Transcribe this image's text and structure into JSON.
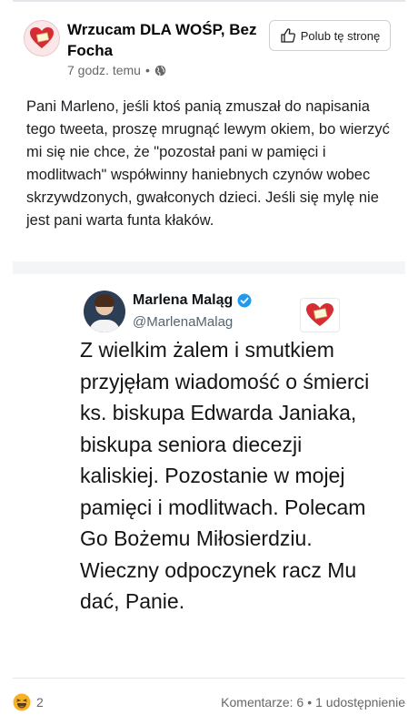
{
  "post": {
    "page_name": "Wrzucam DLA WOŚP, Bez Focha",
    "time": "7 godz. temu",
    "separator": "•",
    "like_page_button": "Polub tę stronę",
    "text": "Pani Marleno, jeśli ktoś panią zmuszał do napisania tego tweeta, proszę mrugnąć lewym okiem, bo wierzyć mi się nie chce, że \"pozostał pani w pamięci i modlitwach\" współwinny haniebnych czynów wobec skrzywdzonych, gwałconych dzieci. Jeśli się mylę nie jest pani warta funta kłaków."
  },
  "tweet": {
    "name": "Marlena Maląg",
    "handle": "@MarlenaMalag",
    "text": "Z wielkim żalem i smutkiem przyjęłam wiadomość o śmierci ks. biskupa Edwarda Janiaka, biskupa seniora diecezji kaliskiej. Pozostanie w mojej pamięci i modlitwach. Polecam Go Bożemu Miłosierdziu. Wieczny odpoczynek racz Mu dać, Panie."
  },
  "footer": {
    "reaction_count": "2",
    "comments": "Komentarze: 6",
    "dot": "•",
    "shares": "1 udostępnienie"
  },
  "icons": {
    "page_avatar": "heart-icon",
    "privacy": "globe-icon",
    "like": "thumbs-up-icon",
    "verified": "verified-badge-icon",
    "reaction": "haha-emoji-icon"
  },
  "colors": {
    "verified_blue": "#1d9bf0",
    "heart_red": "#d62d35",
    "meta_gray": "#65676b"
  }
}
